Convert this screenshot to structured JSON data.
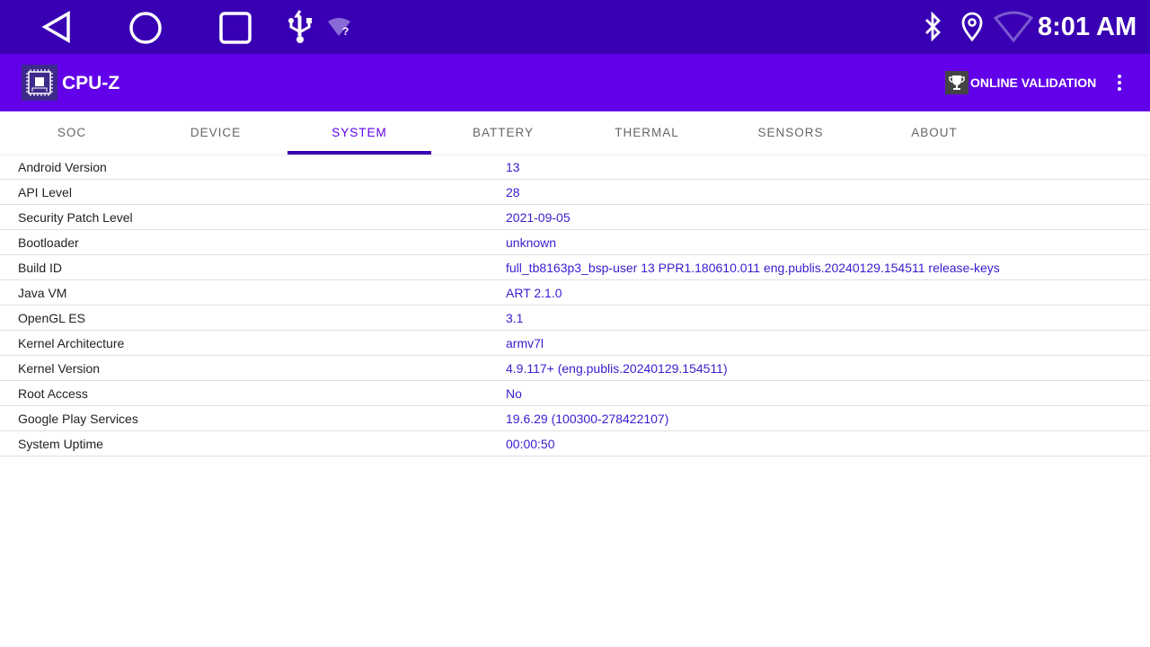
{
  "statusbar": {
    "time": "8:01 AM"
  },
  "appbar": {
    "title": "CPU-Z",
    "validation_label": "ONLINE VALIDATION"
  },
  "tabs": [
    {
      "label": "SOC"
    },
    {
      "label": "DEVICE"
    },
    {
      "label": "SYSTEM"
    },
    {
      "label": "BATTERY"
    },
    {
      "label": "THERMAL"
    },
    {
      "label": "SENSORS"
    },
    {
      "label": "ABOUT"
    }
  ],
  "active_tab": "SYSTEM",
  "rows": [
    {
      "key": "Android Version",
      "value": "13"
    },
    {
      "key": "API Level",
      "value": "28"
    },
    {
      "key": "Security Patch Level",
      "value": "2021-09-05"
    },
    {
      "key": "Bootloader",
      "value": "unknown"
    },
    {
      "key": "Build ID",
      "value": "full_tb8163p3_bsp-user 13 PPR1.180610.011 eng.publis.20240129.154511 release-keys"
    },
    {
      "key": "Java VM",
      "value": "ART 2.1.0"
    },
    {
      "key": "OpenGL ES",
      "value": "3.1"
    },
    {
      "key": "Kernel Architecture",
      "value": "armv7l"
    },
    {
      "key": "Kernel Version",
      "value": "4.9.117+ (eng.publis.20240129.154511)"
    },
    {
      "key": "Root Access",
      "value": "No"
    },
    {
      "key": "Google Play Services",
      "value": "19.6.29 (100300-278422107)"
    },
    {
      "key": "System Uptime",
      "value": "00:00:50"
    }
  ]
}
